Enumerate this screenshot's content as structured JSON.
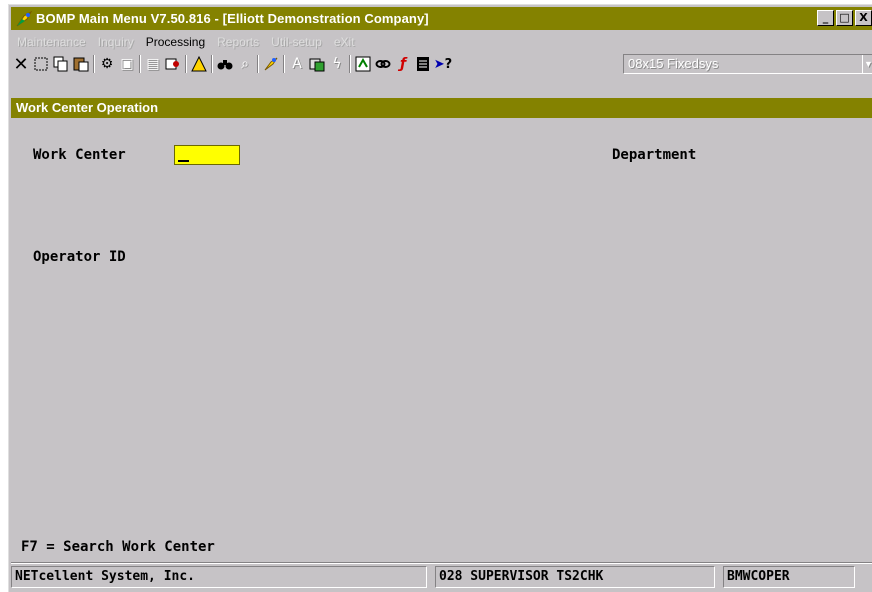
{
  "window": {
    "title": "BOMP Main Menu V7.50.816 - [Elliott Demonstration Company]",
    "minimize_glyph": "_",
    "maximize_glyph": "□",
    "close_glyph": "X"
  },
  "menu": {
    "items": [
      {
        "label": "Maintenance",
        "enabled": false
      },
      {
        "label": "Inquiry",
        "enabled": false
      },
      {
        "label": "Processing",
        "enabled": true
      },
      {
        "label": "Reports",
        "enabled": false
      },
      {
        "label": "Util-setup",
        "enabled": false
      },
      {
        "label": "eXit",
        "enabled": false
      }
    ]
  },
  "toolbar": {
    "font_combo_value": "08x15 Fixedsys",
    "icons": [
      "close-x-icon",
      "select-rect-icon",
      "copy-icon",
      "paste-icon",
      "settings-gear-icon",
      "properties-icon",
      "list-icon",
      "find-person-icon",
      "warning-icon",
      "binoculars-icon",
      "zoom-icon",
      "globe-icon",
      "font-icon",
      "gallery-icon",
      "lightning-icon",
      "calculator-icon",
      "link-icon",
      "function-icon",
      "notepad-icon",
      "help-pointer-icon"
    ]
  },
  "screen": {
    "header": "Work Center Operation",
    "work_center_label": "Work Center",
    "work_center_value": "",
    "department_label": "Department",
    "operator_label": "Operator ID",
    "hint": "F7 = Search Work Center"
  },
  "status": {
    "company": "NETcellent System, Inc.",
    "session": "028 SUPERVISOR TS2CHK",
    "program": "BMWCOPER"
  },
  "colors": {
    "title_bar": "#848200",
    "face": "#c6c3c6",
    "input_highlight": "#ffff00"
  }
}
